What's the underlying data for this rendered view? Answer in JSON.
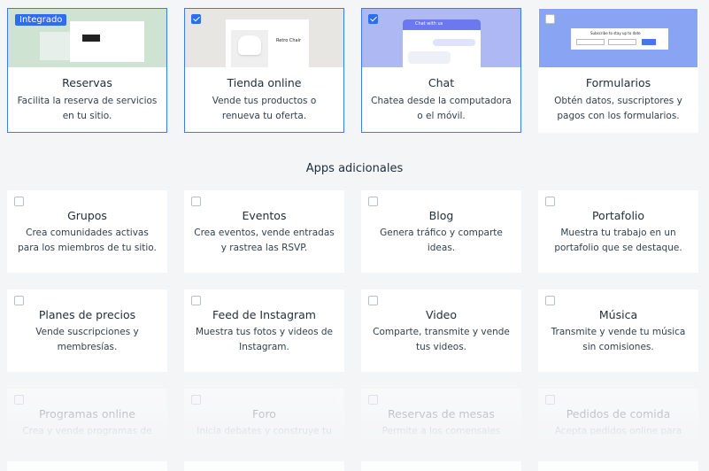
{
  "featured": [
    {
      "title": "Reservas",
      "desc": "Facilita la reserva de servicios en tu sitio.",
      "badge": "Integrado",
      "checked": false,
      "selected": true
    },
    {
      "title": "Tienda online",
      "desc": "Vende tus productos o renueva tu oferta.",
      "checked": true,
      "selected": true
    },
    {
      "title": "Chat",
      "desc": "Chatea desde la computadora o el móvil.",
      "checked": true,
      "selected": true
    },
    {
      "title": "Formularios",
      "desc": "Obtén datos, suscriptores y pagos con los formularios.",
      "checked": false,
      "selected": false
    }
  ],
  "section_title": "Apps adicionales",
  "apps": [
    {
      "title": "Grupos",
      "desc": "Crea comunidades activas para los miembros de tu sitio."
    },
    {
      "title": "Eventos",
      "desc": "Crea eventos, vende entradas y rastrea las RSVP."
    },
    {
      "title": "Blog",
      "desc": "Genera tráfico y comparte ideas."
    },
    {
      "title": "Portafolio",
      "desc": "Muestra tu trabajo en un portafolio que se destaque."
    },
    {
      "title": "Planes de precios",
      "desc": "Vende suscripciones y membresías."
    },
    {
      "title": "Feed de Instagram",
      "desc": "Muestra tus fotos y videos de Instagram."
    },
    {
      "title": "Video",
      "desc": "Comparte, transmite y vende tus videos."
    },
    {
      "title": "Música",
      "desc": "Transmite y vende tu música sin comisiones."
    },
    {
      "title": "Programas online",
      "desc": "Crea y vende programas de"
    },
    {
      "title": "Foro",
      "desc": "Inicia debates y construye tu"
    },
    {
      "title": "Reservas de mesas",
      "desc": "Permite a los comensales"
    },
    {
      "title": "Pedidos de comida",
      "desc": "Acepta pedidos online para"
    }
  ],
  "thumb_text": {
    "shop_heading": "Retro Chair",
    "chat_header": "Chat with us",
    "form_heading": "Subscribe to stay up to date"
  },
  "colors": {
    "accent": "#2f6df0",
    "background": "#f4f5f7"
  }
}
